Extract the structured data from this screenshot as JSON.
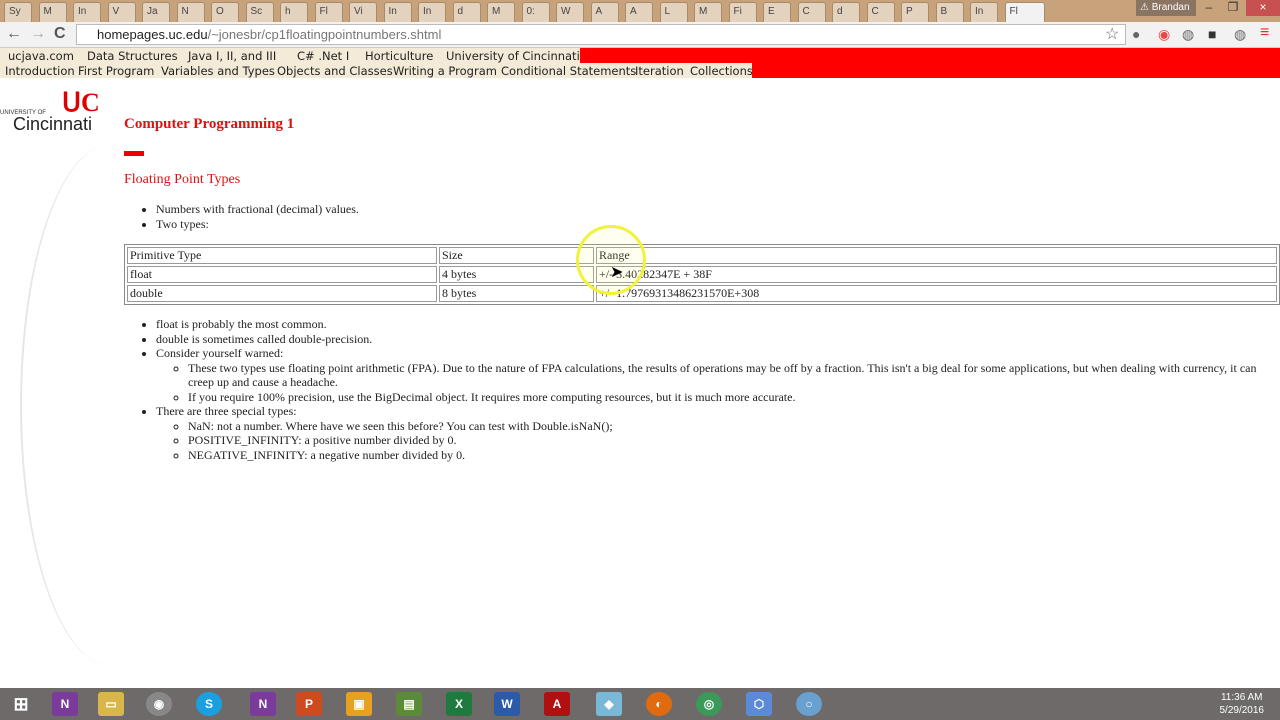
{
  "browser": {
    "tabs": [
      "Sy",
      "M",
      "In",
      "V",
      "Ja",
      "N",
      "O",
      "Sc",
      "h",
      "Fl",
      "Vi",
      "In",
      "In",
      "d",
      "M",
      "0:",
      "W",
      "A",
      "A",
      "L",
      "M",
      "Fi",
      "E",
      "C",
      "d",
      "C",
      "P",
      "B",
      "In",
      "Fl"
    ],
    "user": "Brandan",
    "url_host": "homepages.uc.edu",
    "url_path": "/~jonesbr/cp1floatingpointnumbers.shtml",
    "buttons": {
      "back": "←",
      "forward": "→",
      "reload": "C",
      "star": "☆",
      "menu": "≡",
      "minimize": "–",
      "maximize": "❐",
      "close": "×"
    }
  },
  "site_nav": {
    "top": [
      "ucjava.com",
      "Data Structures",
      "Java I, II, and III",
      "C# .Net I",
      "Horticulture",
      "University of Cincinnati"
    ],
    "sub": [
      "Introduction",
      "First Program",
      "Variables and Types",
      "Objects and Classes",
      "Writing a Program",
      "Conditional Statements",
      "Iteration",
      "Collections"
    ],
    "accent": "#ff0000"
  },
  "logo": {
    "small": "UNIVERSITY OF",
    "big": "Cincinnati",
    "mark": "UC"
  },
  "page": {
    "title": "Computer Programming 1",
    "section": "Floating Point Types",
    "intro": [
      "Numbers with fractional (decimal) values.",
      "Two types:"
    ],
    "table": {
      "headers": [
        "Primitive Type",
        "Size",
        "Range"
      ],
      "rows": [
        [
          "float",
          "4 bytes",
          "+/- 3.40282347E + 38F"
        ],
        [
          "double",
          "8 bytes",
          "+/- 1.79769313486231570E+308"
        ]
      ]
    },
    "notes": {
      "a": "float is probably the most common.",
      "b": "double is sometimes called double-precision.",
      "c": "Consider yourself warned:",
      "c_sub": [
        "These two types use floating point arithmetic (FPA).  Due to the nature of FPA calculations, the results of operations may be off by a fraction.  This isn't a big deal for some applications, but when dealing with currency, it can creep up and cause a headache.",
        "If you require 100% precision, use the BigDecimal object.  It requires more computing resources, but it is much more accurate."
      ],
      "d": "There are three special types:",
      "d_sub": [
        "NaN: not a number.  Where have we seen this before?  You can test with Double.isNaN();",
        "POSITIVE_INFINITY: a positive number divided by 0.",
        "NEGATIVE_INFINITY: a negative number divided by 0."
      ]
    }
  },
  "taskbar": {
    "time": "11:36 AM",
    "date": "5/29/2016"
  }
}
